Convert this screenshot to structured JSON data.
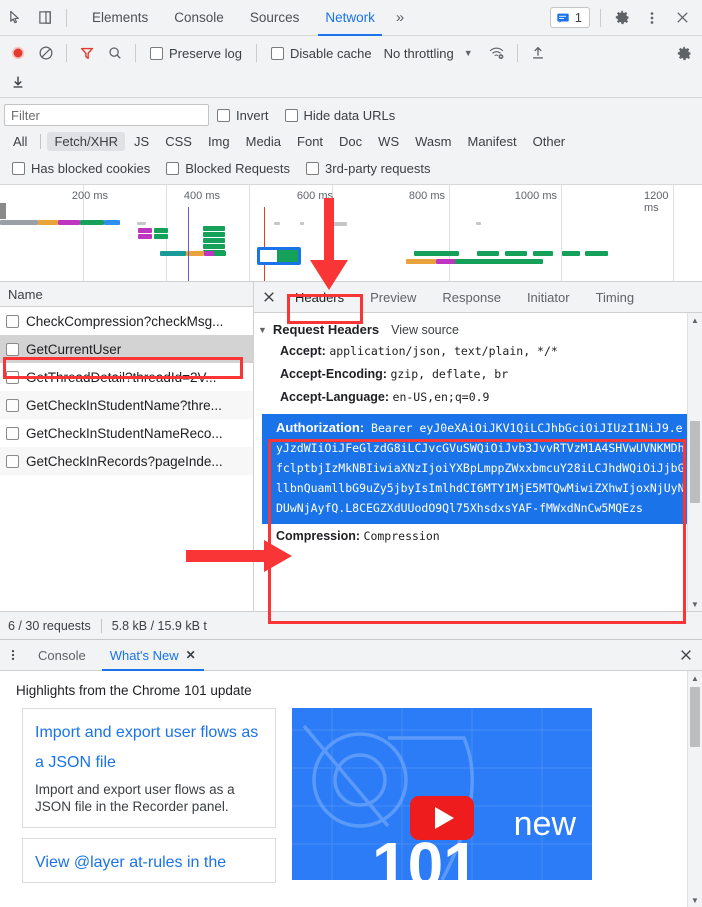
{
  "window": {
    "inspect_icon": "inspect-cursor-icon",
    "device_icon": "device-toolbar-icon",
    "more_tabs": "»",
    "messages_count": "1",
    "settings_icon": "gear-icon",
    "more_icon": "kebab-menu-icon",
    "close_icon": "close-icon"
  },
  "main_tabs": [
    {
      "label": "Elements",
      "active": false
    },
    {
      "label": "Console",
      "active": false
    },
    {
      "label": "Sources",
      "active": false
    },
    {
      "label": "Network",
      "active": true
    }
  ],
  "network_toolbar": {
    "record_icon": "record-button",
    "clear_icon": "clear-icon",
    "filter_icon": "filter-funnel-icon",
    "search_icon": "search-icon",
    "preserve_log": "Preserve log",
    "disable_cache": "Disable cache",
    "throttling": "No throttling",
    "wifi_icon": "network-conditions-icon",
    "import_icon": "import-har-icon",
    "export_icon": "export-har-icon",
    "settings_icon": "network-settings-gear-icon"
  },
  "filter": {
    "placeholder": "Filter",
    "value": "",
    "invert": "Invert",
    "hide_data_urls": "Hide data URLs",
    "types": [
      {
        "label": "All",
        "selected": false
      },
      {
        "label": "Fetch/XHR",
        "selected": true
      },
      {
        "label": "JS",
        "selected": false
      },
      {
        "label": "CSS",
        "selected": false
      },
      {
        "label": "Img",
        "selected": false
      },
      {
        "label": "Media",
        "selected": false
      },
      {
        "label": "Font",
        "selected": false
      },
      {
        "label": "Doc",
        "selected": false
      },
      {
        "label": "WS",
        "selected": false
      },
      {
        "label": "Wasm",
        "selected": false
      },
      {
        "label": "Manifest",
        "selected": false
      },
      {
        "label": "Other",
        "selected": false
      }
    ],
    "has_blocked_cookies": "Has blocked cookies",
    "blocked_requests": "Blocked Requests",
    "third_party": "3rd-party requests"
  },
  "overview": {
    "ticks": [
      "200 ms",
      "400 ms",
      "600 ms",
      "800 ms",
      "1000 ms",
      "1200 ms"
    ]
  },
  "requests": {
    "column_header": "Name",
    "rows": [
      {
        "name": "CheckCompression?checkMsg...",
        "selected": false
      },
      {
        "name": "GetCurrentUser",
        "selected": true
      },
      {
        "name": "GetThreadDetail?threadId=2V...",
        "selected": false
      },
      {
        "name": "GetCheckInStudentName?thre...",
        "selected": false
      },
      {
        "name": "GetCheckInStudentNameReco...",
        "selected": false
      },
      {
        "name": "GetCheckInRecords?pageInde...",
        "selected": false
      }
    ]
  },
  "status_bar": {
    "requests": "6 / 30 requests",
    "transferred": "5.8 kB / 15.9 kB t"
  },
  "detail": {
    "close_icon": "close-icon",
    "tabs": [
      {
        "label": "Headers",
        "active": true
      },
      {
        "label": "Preview",
        "active": false
      },
      {
        "label": "Response",
        "active": false
      },
      {
        "label": "Initiator",
        "active": false
      },
      {
        "label": "Timing",
        "active": false
      }
    ],
    "section_title": "Request Headers",
    "view_source": "View source",
    "headers": [
      {
        "key": "Accept:",
        "value": "application/json, text/plain, */*"
      },
      {
        "key": "Accept-Encoding:",
        "value": "gzip, deflate, br"
      },
      {
        "key": "Accept-Language:",
        "value": "en-US,en;q=0.9"
      }
    ],
    "authorization": {
      "key": "Authorization:",
      "value": "Bearer eyJ0eXAiOiJKV1QiLCJhbGciOiJIUzI1NiJ9.eyJzdWIiOiJFeGlzdG8iLCJvcGVuSWQiOiJvb3JvvRTVzM1A4SHVwUVNKMDhfclptbjIzMkNBIiwiaXNzIjoiYXBpLmppZWxxbmcuY28iLCJhdWQiOiJjbGllbnQuamllbG9uZy5jbyIsImlhdCI6MTY1MjE5MTQwMiwiZXhwIjoxNjUyNDUwNjAyfQ.L8CEGZXdUUodO9Ql75XhsdxsYAF-fMWxdNnCw5MQEzs"
    },
    "compression": {
      "key": "Compression:",
      "value": "Compression"
    }
  },
  "drawer": {
    "menu_icon": "kebab-menu-icon",
    "tabs": [
      {
        "label": "Console",
        "active": false,
        "closable": false
      },
      {
        "label": "What's New",
        "active": true,
        "closable": true
      }
    ],
    "close_icon": "close-icon",
    "heading": "Highlights from the Chrome 101 update",
    "cards": [
      {
        "title": "Import and export user flows as a JSON file",
        "desc": "Import and export user flows as a JSON file in the Recorder panel."
      },
      {
        "title": "View @layer at-rules in the",
        "desc": ""
      }
    ],
    "video": {
      "label_new": "new",
      "play_icon": "youtube-play-icon"
    }
  },
  "colors": {
    "accent": "#1a73e8",
    "annotation": "#f93535",
    "toolbar_bg": "#f1f3f4"
  }
}
